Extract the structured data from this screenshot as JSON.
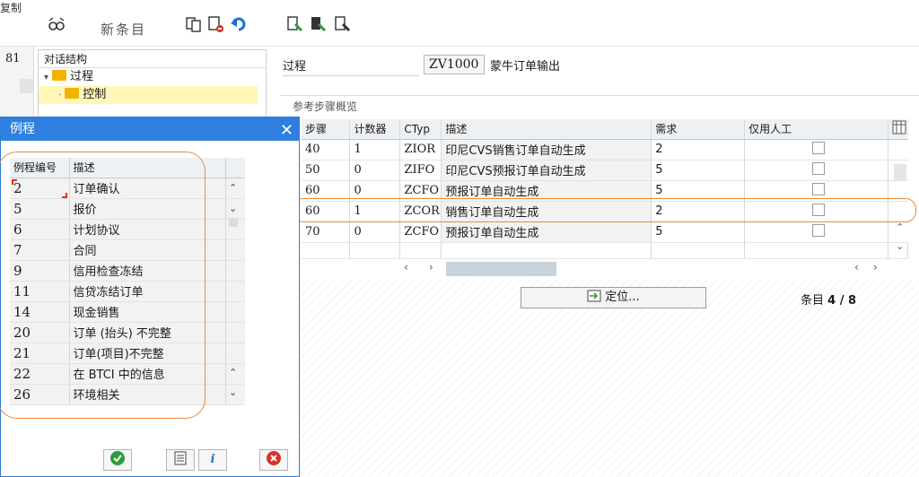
{
  "toolbar": {
    "copy_label": "复制",
    "new_entry_label": "新条目"
  },
  "left_strip": {
    "value": "81"
  },
  "tree": {
    "header": "对话结构",
    "items": [
      {
        "label": "过程"
      },
      {
        "label": "控制"
      }
    ]
  },
  "process": {
    "label": "过程",
    "code": "ZV1000",
    "description": "蒙牛订单输出"
  },
  "steps": {
    "title": "参考步骤概览",
    "columns": [
      "步骤",
      "计数器",
      "CTyp",
      "描述",
      "需求",
      "仅用人工"
    ],
    "rows": [
      {
        "step": "40",
        "counter": "1",
        "ctyp": "ZIOR",
        "desc": "印尼CVS销售订单自动生成",
        "req": "2"
      },
      {
        "step": "50",
        "counter": "0",
        "ctyp": "ZIFO",
        "desc": "印尼CVS预报订单自动生成",
        "req": "5"
      },
      {
        "step": "60",
        "counter": "0",
        "ctyp": "ZCFO",
        "desc": "预报订单自动生成",
        "req": "5"
      },
      {
        "step": "60",
        "counter": "1",
        "ctyp": "ZCOR",
        "desc": "销售订单自动生成",
        "req": "2"
      },
      {
        "step": "70",
        "counter": "0",
        "ctyp": "ZCFO",
        "desc": "预报订单自动生成",
        "req": "5"
      }
    ],
    "position_button": "定位...",
    "entries_label": "条目",
    "entries_value": "4 / 8"
  },
  "dialog": {
    "title": "例程",
    "columns": [
      "例程编号",
      "描述"
    ],
    "rows": [
      {
        "no": "2",
        "desc": "订单确认"
      },
      {
        "no": "5",
        "desc": "报价"
      },
      {
        "no": "6",
        "desc": "计划协议"
      },
      {
        "no": "7",
        "desc": "合同"
      },
      {
        "no": "9",
        "desc": "信用检查冻结"
      },
      {
        "no": "11",
        "desc": "信贷冻结订单"
      },
      {
        "no": "14",
        "desc": "现金销售"
      },
      {
        "no": "20",
        "desc": "订单 (抬头) 不完整"
      },
      {
        "no": "21",
        "desc": "订单(项目)不完整"
      },
      {
        "no": "22",
        "desc": "在 BTCI 中的信息"
      },
      {
        "no": "26",
        "desc": "环境相关"
      }
    ]
  },
  "colors": {
    "dialog_title_bg": "#2f7fe0",
    "highlight_orange": "#e88a3b",
    "folder_yellow": "#f2b300",
    "ok_green": "#2e9c3a",
    "cancel_red": "#d9312b"
  }
}
